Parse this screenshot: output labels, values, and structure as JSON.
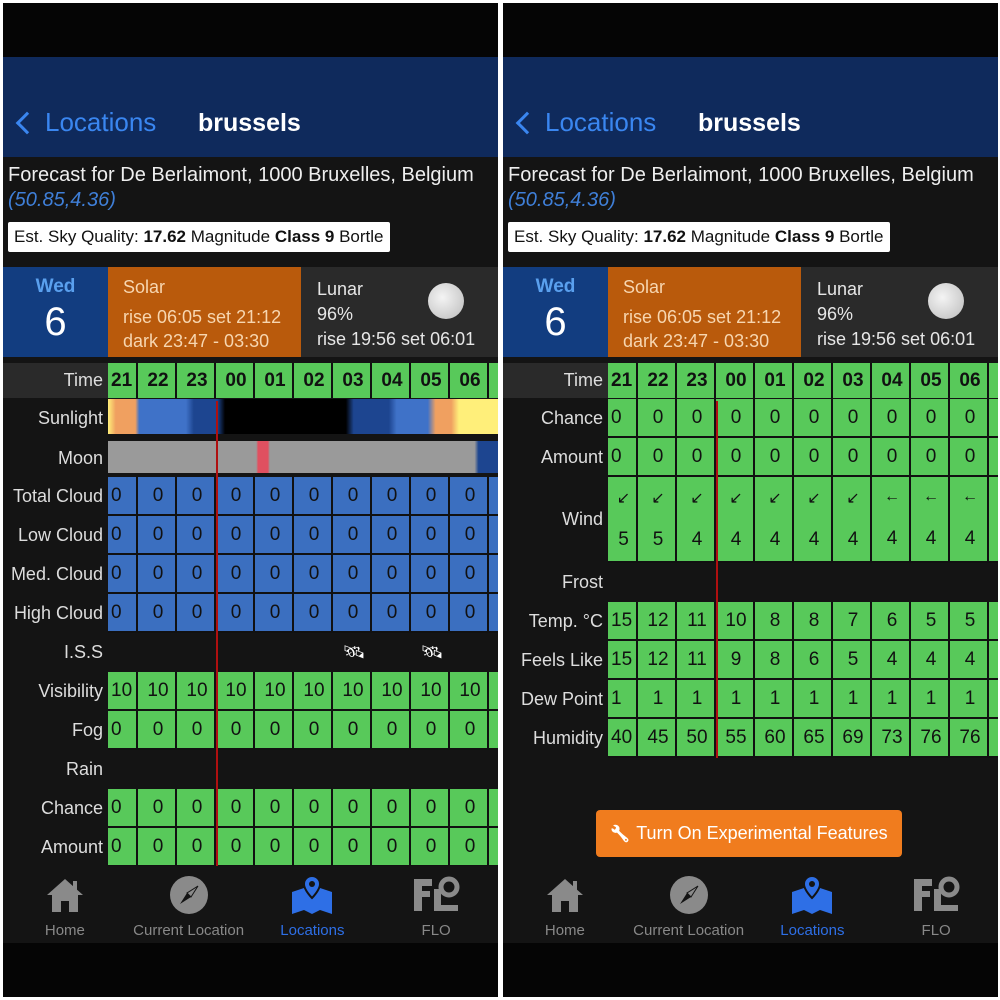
{
  "header": {
    "back_label": "Locations",
    "title": "brussels"
  },
  "forecast": {
    "text": "Forecast for De Berlaimont, 1000 Bruxelles, Belgium",
    "coords": "(50.85,4.36)"
  },
  "sky": {
    "prefix": "Est. Sky Quality: ",
    "value": "17.62",
    "mid": " Magnitude ",
    "cls": "Class 9",
    "suffix": " Bortle"
  },
  "day": {
    "weekday": "Wed",
    "date": "6"
  },
  "solar": {
    "title": "Solar",
    "line1": "rise 06:05 set 21:12",
    "line2": "dark 23:47 - 03:30"
  },
  "lunar": {
    "title": "Lunar",
    "percent": "96%",
    "line": "rise 19:56 set 06:01",
    "icon": "moon-icon"
  },
  "time_label": "Time",
  "hours": [
    "21",
    "22",
    "23",
    "00",
    "01",
    "02",
    "03",
    "04",
    "05",
    "06"
  ],
  "colors": {
    "green": "#58c95a",
    "blue": "#3b6fc0",
    "orange": "#b95a0c",
    "accent": "#2e6fe6",
    "button": "#f07c1e"
  },
  "left_rows": [
    {
      "label": "Sunlight",
      "type": "sunlight"
    },
    {
      "label": "Moon",
      "type": "moon"
    },
    {
      "label": "Total Cloud",
      "type": "blue",
      "values": [
        "0",
        "0",
        "0",
        "0",
        "0",
        "0",
        "0",
        "0",
        "0",
        "0"
      ]
    },
    {
      "label": "Low Cloud",
      "type": "blue",
      "values": [
        "0",
        "0",
        "0",
        "0",
        "0",
        "0",
        "0",
        "0",
        "0",
        "0"
      ]
    },
    {
      "label": "Med. Cloud",
      "type": "blue",
      "values": [
        "0",
        "0",
        "0",
        "0",
        "0",
        "0",
        "0",
        "0",
        "0",
        "0"
      ]
    },
    {
      "label": "High Cloud",
      "type": "blue",
      "values": [
        "0",
        "0",
        "0",
        "0",
        "0",
        "0",
        "0",
        "0",
        "0",
        "0"
      ]
    },
    {
      "label": "I.S.S",
      "type": "iss",
      "passes": [
        "03",
        "05"
      ]
    },
    {
      "label": "Visibility",
      "type": "green",
      "values": [
        "10",
        "10",
        "10",
        "10",
        "10",
        "10",
        "10",
        "10",
        "10",
        "10"
      ]
    },
    {
      "label": "Fog",
      "type": "green",
      "values": [
        "0",
        "0",
        "0",
        "0",
        "0",
        "0",
        "0",
        "0",
        "0",
        "0"
      ]
    },
    {
      "label": "Rain",
      "type": "empty"
    },
    {
      "label": "Chance",
      "type": "green",
      "values": [
        "0",
        "0",
        "0",
        "0",
        "0",
        "0",
        "0",
        "0",
        "0",
        "0"
      ]
    },
    {
      "label": "Amount",
      "type": "green",
      "values": [
        "0",
        "0",
        "0",
        "0",
        "0",
        "0",
        "0",
        "0",
        "0",
        "0"
      ]
    }
  ],
  "right_rows": [
    {
      "label": "Chance",
      "type": "green",
      "values": [
        "0",
        "0",
        "0",
        "0",
        "0",
        "0",
        "0",
        "0",
        "0",
        "0"
      ]
    },
    {
      "label": "Amount",
      "type": "green",
      "values": [
        "0",
        "0",
        "0",
        "0",
        "0",
        "0",
        "0",
        "0",
        "0",
        "0"
      ]
    },
    {
      "label": "Wind",
      "type": "wind",
      "arrows": [
        "↙",
        "↙",
        "↙",
        "↙",
        "↙",
        "↙",
        "↙",
        "←",
        "←",
        "←"
      ],
      "values": [
        "5",
        "5",
        "4",
        "4",
        "4",
        "4",
        "4",
        "4",
        "4",
        "4"
      ]
    },
    {
      "label": "Frost",
      "type": "empty"
    },
    {
      "label": "Temp. °C",
      "type": "green",
      "values": [
        "15",
        "12",
        "11",
        "10",
        "8",
        "8",
        "7",
        "6",
        "5",
        "5"
      ]
    },
    {
      "label": "Feels Like",
      "type": "green",
      "values": [
        "15",
        "12",
        "11",
        "9",
        "8",
        "6",
        "5",
        "4",
        "4",
        "4"
      ]
    },
    {
      "label": "Dew Point",
      "type": "green",
      "values": [
        "1",
        "1",
        "1",
        "1",
        "1",
        "1",
        "1",
        "1",
        "1",
        "1"
      ]
    },
    {
      "label": "Humidity",
      "type": "green",
      "values": [
        "40",
        "45",
        "50",
        "55",
        "60",
        "65",
        "69",
        "73",
        "76",
        "76"
      ]
    }
  ],
  "experimental_button": "Turn On Experimental Features",
  "tabs": [
    {
      "label": "Home",
      "icon": "home-icon"
    },
    {
      "label": "Current Location",
      "icon": "compass-icon"
    },
    {
      "label": "Locations",
      "icon": "map-pin-icon",
      "active": true
    },
    {
      "label": "FLO",
      "icon": "flo-icon"
    }
  ]
}
